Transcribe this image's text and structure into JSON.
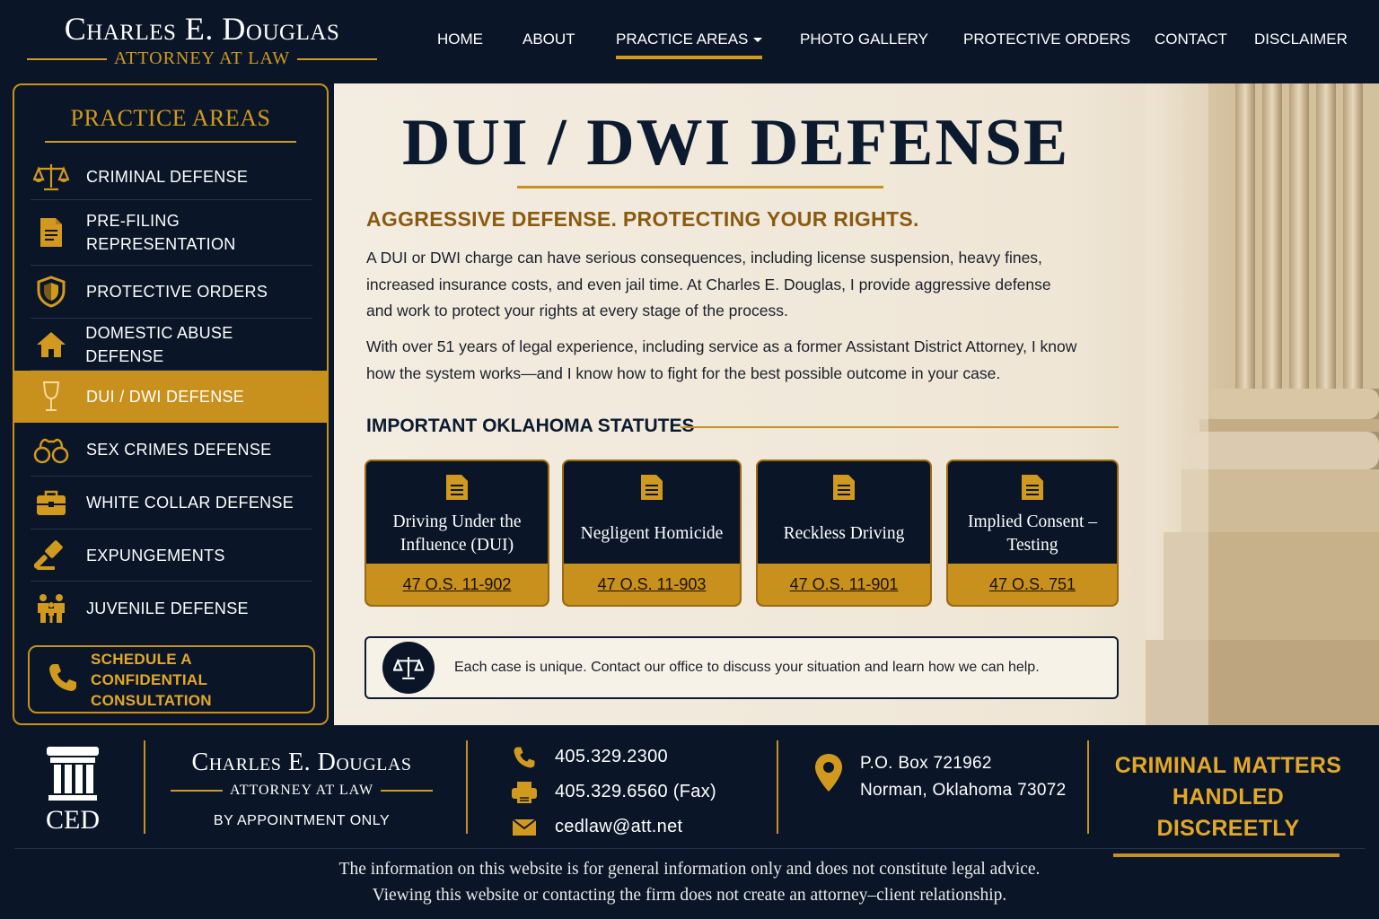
{
  "header": {
    "logo_name": "Charles E. Douglas",
    "logo_subtitle": "ATTORNEY AT LAW"
  },
  "nav": {
    "items": [
      {
        "label": "HOME"
      },
      {
        "label": "ABOUT"
      },
      {
        "label": "PRACTICE AREAS"
      },
      {
        "label": "PHOTO GALLERY"
      },
      {
        "label": "PROTECTIVE ORDERS"
      },
      {
        "label": "CONTACT"
      },
      {
        "label": "DISCLAIMER"
      }
    ],
    "active": "PRACTICE AREAS"
  },
  "sidebar": {
    "title": "PRACTICE AREAS",
    "items": [
      {
        "label": "CRIMINAL DEFENSE",
        "icon": "scales-icon"
      },
      {
        "label": "PRE-FILING REPRESENTATION",
        "icon": "document-icon"
      },
      {
        "label": "PROTECTIVE ORDERS",
        "icon": "shield-icon"
      },
      {
        "label": "DOMESTIC ABUSE DEFENSE",
        "icon": "house-icon"
      },
      {
        "label": "DUI / DWI DEFENSE",
        "icon": "wine-glass-icon"
      },
      {
        "label": "SEX CRIMES DEFENSE",
        "icon": "handcuffs-icon"
      },
      {
        "label": "WHITE COLLAR DEFENSE",
        "icon": "briefcase-icon"
      },
      {
        "label": "EXPUNGEMENTS",
        "icon": "gavel-icon"
      },
      {
        "label": "JUVENILE DEFENSE",
        "icon": "family-icon"
      }
    ],
    "active": "DUI / DWI DEFENSE",
    "cta_label": "SCHEDULE A CONFIDENTIAL CONSULTATION"
  },
  "main": {
    "title": "DUI / DWI DEFENSE",
    "tagline": "AGGRESSIVE DEFENSE. PROTECTING YOUR RIGHTS.",
    "paragraph1": "A DUI or DWI charge can have serious consequences, including license suspension, heavy fines, increased insurance costs, and even jail time. At Charles E. Douglas, I provide aggressive defense and work to protect your rights at every stage of the process.",
    "paragraph2": "With over 51 years of legal experience, including service as a former Assistant District Attorney, I know how the system works—and I know how to fight for the best possible outcome in your case.",
    "statutes_heading": "IMPORTANT OKLAHOMA STATUTES",
    "statutes": [
      {
        "title": "Driving Under the Influence (DUI)",
        "cite": "47 O.S. 11-902"
      },
      {
        "title": "Negligent Homicide",
        "cite": "47 O.S. 11-903"
      },
      {
        "title": "Reckless Driving",
        "cite": "47 O.S. 11-901"
      },
      {
        "title": "Implied Consent – Testing",
        "cite": "47 O.S. 751"
      }
    ],
    "notice": "Each case is unique. Contact our office to discuss your situation and learn how we can help."
  },
  "footer": {
    "logo_text": "CED",
    "name": "Charles E. Douglas",
    "subtitle": "ATTORNEY AT LAW",
    "appointment": "BY APPOINTMENT ONLY",
    "phone": "405.329.2300",
    "fax": "405.329.6560 (Fax)",
    "email": "cedlaw@att.net",
    "address_line1": "P.O. Box 721962",
    "address_line2": "Norman, Oklahoma 73072",
    "tagline_line1": "CRIMINAL MATTERS",
    "tagline_line2": "HANDLED DISCREETLY",
    "disclaimer_line1": "The information on this website is for general information only and does not constitute legal advice.",
    "disclaimer_line2": "Viewing this website or contacting the firm does not create an attorney–client relationship."
  },
  "colors": {
    "navy": "#0a1628",
    "gold": "#c8901c",
    "parchment": "#f3ece0"
  }
}
